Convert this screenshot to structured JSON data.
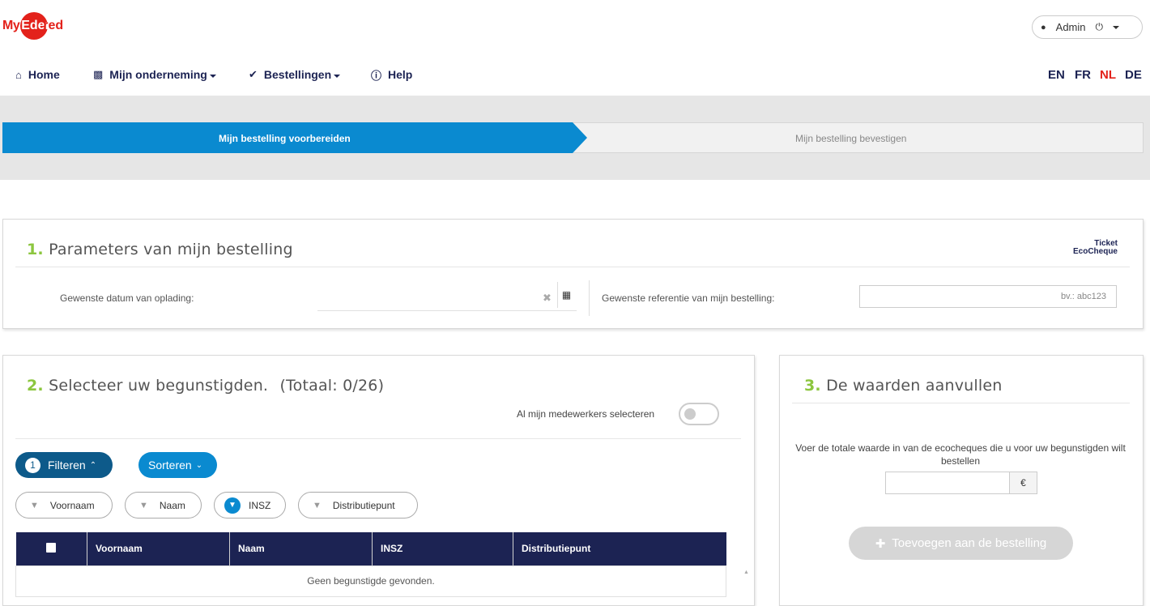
{
  "brand": {
    "logo_my": "My",
    "logo_circle": "Eden",
    "logo_rest": "red"
  },
  "user_menu": {
    "name": "Admin",
    "user_icon": "user-icon",
    "power_icon": "power-icon"
  },
  "nav": {
    "home": "Home",
    "company": "Mijn onderneming",
    "orders": "Bestellingen",
    "help": "Help"
  },
  "languages": [
    {
      "code": "EN",
      "active": false
    },
    {
      "code": "FR",
      "active": false
    },
    {
      "code": "NL",
      "active": true
    },
    {
      "code": "DE",
      "active": false
    }
  ],
  "stepper": {
    "step1": "Mijn bestelling voorbereiden",
    "step2": "Mijn bestelling bevestigen",
    "active_color": "#0a8ad0"
  },
  "section1": {
    "num": "1.",
    "title": "Parameters van mijn bestelling",
    "product_logo_line1": "Ticket",
    "product_logo_line2": "EcoCheque",
    "date_label": "Gewenste datum van oplading:",
    "date_value": "",
    "ref_label": "Gewenste referentie van mijn bestelling:",
    "ref_placeholder": "bv.: abc123"
  },
  "section2": {
    "num": "2.",
    "title": "Selecteer uw begunstigden.",
    "total": "(Totaal: 0/26)",
    "select_all_label": "Al mijn medewerkers selecteren",
    "select_all_on": false,
    "filter_button": {
      "count": "1",
      "label": "Filteren"
    },
    "sort_button": {
      "label": "Sorteren"
    },
    "filter_chips": [
      {
        "label": "Voornaam",
        "active": false
      },
      {
        "label": "Naam",
        "active": false
      },
      {
        "label": "INSZ",
        "active": true
      },
      {
        "label": "Distributiepunt",
        "active": false
      }
    ],
    "table": {
      "columns": [
        "Voornaam",
        "Naam",
        "INSZ",
        "Distributiepunt"
      ],
      "empty_message": "Geen begunstigde gevonden."
    }
  },
  "section3": {
    "num": "3.",
    "title": "De waarden aanvullen",
    "instruction": "Voer de totale waarde in van de ecocheques die u voor uw begunstigden wilt bestellen",
    "amount_value": "",
    "currency": "€",
    "add_button": "Toevoegen aan de bestelling"
  },
  "colors": {
    "navy": "#1c2353",
    "brand_red": "#e3221b",
    "step_blue": "#0a8ad0",
    "filter_dark": "#0d5a8a",
    "accent_green": "#8cc63f"
  }
}
